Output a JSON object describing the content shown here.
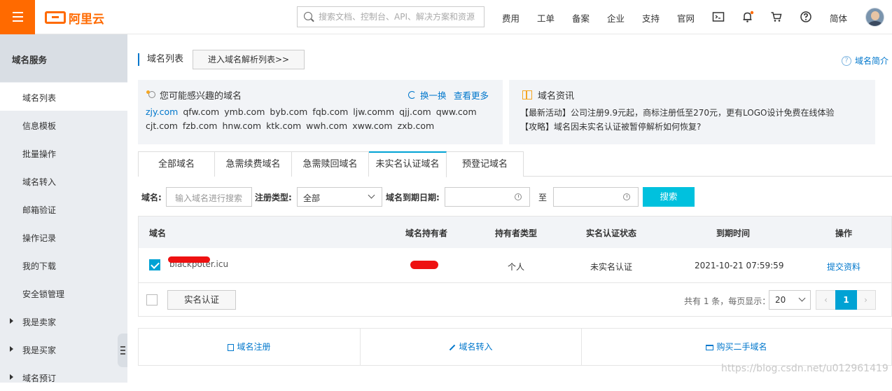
{
  "header": {
    "logo_text": "阿里云",
    "search_placeholder": "搜索文档、控制台、API、解决方案和资源",
    "nav": [
      "费用",
      "工单",
      "备案",
      "企业",
      "支持",
      "官网"
    ],
    "lang": "简体"
  },
  "sidebar": {
    "title": "域名服务",
    "items": [
      {
        "label": "域名列表"
      },
      {
        "label": "信息模板"
      },
      {
        "label": "批量操作"
      },
      {
        "label": "域名转入"
      },
      {
        "label": "邮箱验证"
      },
      {
        "label": "操作记录"
      },
      {
        "label": "我的下载"
      },
      {
        "label": "安全锁管理"
      },
      {
        "label": "我是卖家"
      },
      {
        "label": "我是买家"
      },
      {
        "label": "域名预订"
      }
    ]
  },
  "main": {
    "title": "域名列表",
    "parse_button": "进入域名解析列表>>",
    "help_link": "域名简介",
    "interest": {
      "title": "您可能感兴趣的域名",
      "refresh": "换一换",
      "more": "查看更多",
      "row1": [
        "zjy.com",
        "qfw.com",
        "ymb.com",
        "byb.com",
        "fqb.com",
        "ljw.comm",
        "qjj.com",
        "qww.com"
      ],
      "row2": [
        "cjt.com",
        "fzb.com",
        "hnw.com",
        "ktk.com",
        "wwh.com",
        "xww.com",
        "zxb.com"
      ]
    },
    "news": {
      "title": "域名资讯",
      "line1": "【最新活动】公司注册9.9元起，商标注册低至270元，更有LOGO设计免费在线体验",
      "line2": "【攻略】域名因未实名认证被暂停解析如何恢复?"
    },
    "tabs": [
      "全部域名",
      "急需续费域名",
      "急需赎回域名",
      "未实名认证域名",
      "预登记域名"
    ],
    "filter": {
      "domain_label": "域名:",
      "domain_placeholder": "输入域名进行搜索",
      "type_label": "注册类型:",
      "type_value": "全部",
      "date_label": "域名到期日期:",
      "to": "至",
      "search_button": "搜索"
    },
    "table": {
      "headers": [
        "域名",
        "域名持有者",
        "持有者类型",
        "实名认证状态",
        "到期时间",
        "操作"
      ],
      "row": {
        "domain": "blackpoter.icu",
        "holder_type": "个人",
        "status": "未实名认证",
        "expire": "2021-10-21 07:59:59",
        "action": "提交资料"
      },
      "verify_button": "实名认证",
      "page_info": "共有 1 条，每页显示：",
      "page_size": "20",
      "current_page": "1",
      "prev": "‹",
      "next": "›"
    },
    "quick_links": [
      "域名注册",
      "域名转入",
      "购买二手域名"
    ]
  },
  "watermark": "https://blog.csdn.net/u012961419"
}
